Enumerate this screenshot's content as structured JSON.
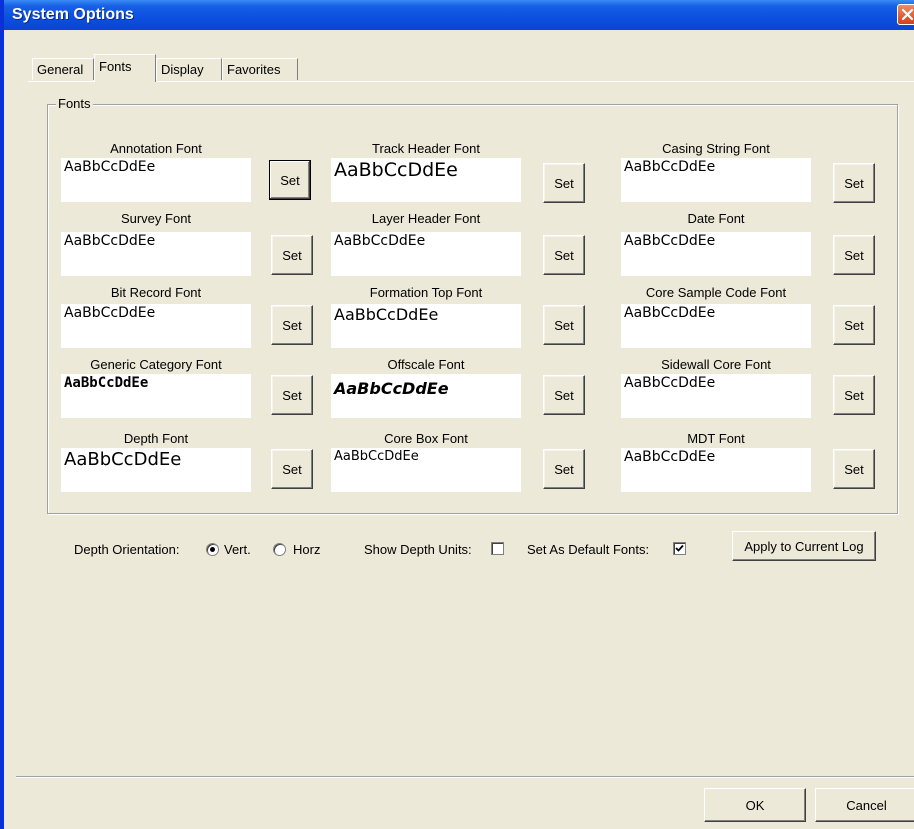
{
  "window": {
    "title": "System Options"
  },
  "tabs": [
    "General",
    "Fonts",
    "Display",
    "Favorites"
  ],
  "active_tab": "Fonts",
  "group": {
    "legend": "Fonts"
  },
  "set_label": "Set",
  "fonts": [
    {
      "label": "Annotation Font",
      "sample": "AaBbCcDdEe"
    },
    {
      "label": "Track Header Font",
      "sample": "AaBbCcDdEe"
    },
    {
      "label": "Casing String Font",
      "sample": "AaBbCcDdEe"
    },
    {
      "label": "Survey Font",
      "sample": "AaBbCcDdEe"
    },
    {
      "label": "Layer Header Font",
      "sample": "AaBbCcDdEe"
    },
    {
      "label": "Date Font",
      "sample": "AaBbCcDdEe"
    },
    {
      "label": "Bit Record Font",
      "sample": "AaBbCcDdEe"
    },
    {
      "label": "Formation Top Font",
      "sample": "AaBbCcDdEe"
    },
    {
      "label": "Core Sample Code Font",
      "sample": "AaBbCcDdEe"
    },
    {
      "label": "Generic Category Font",
      "sample": "AaBbCcDdEe"
    },
    {
      "label": "Offscale Font",
      "sample": "AaBbCcDdEe"
    },
    {
      "label": "Sidewall Core Font",
      "sample": "AaBbCcDdEe"
    },
    {
      "label": "Depth Font",
      "sample": "AaBbCcDdEe"
    },
    {
      "label": "Core Box Font",
      "sample": "AaBbCcDdEe"
    },
    {
      "label": "MDT Font",
      "sample": "AaBbCcDdEe"
    }
  ],
  "options": {
    "depth_orientation_label": "Depth Orientation:",
    "vert_label": "Vert.",
    "horz_label": "Horz",
    "depth_orientation_selected": "Vert.",
    "show_depth_units_label": "Show Depth Units:",
    "show_depth_units_checked": false,
    "set_default_label": "Set As Default Fonts:",
    "set_default_checked": true,
    "apply_label": "Apply to Current Log"
  },
  "footer": {
    "ok_label": "OK",
    "cancel_label": "Cancel"
  },
  "colors": {
    "title_bar": "#0b4fe0",
    "window_border": "#0831d9",
    "face": "#ece9d8",
    "close_button": "#d4401b"
  }
}
